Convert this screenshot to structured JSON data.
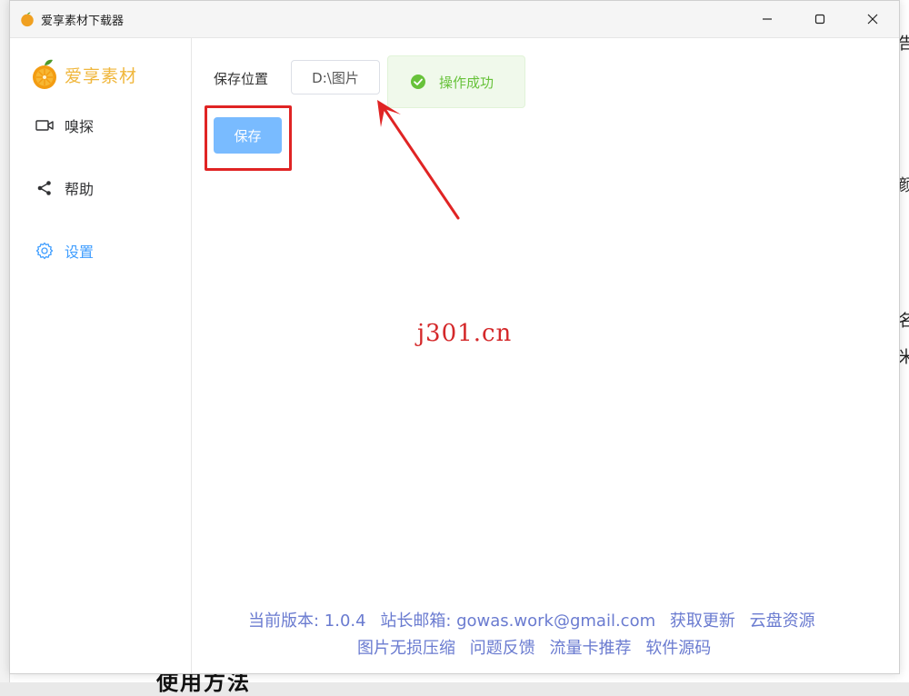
{
  "window": {
    "title": "爱享素材下载器"
  },
  "sidebar": {
    "brand": "爱享素材",
    "items": [
      {
        "label": "嗅探",
        "icon": "video-camera-icon"
      },
      {
        "label": "帮助",
        "icon": "share-icon"
      },
      {
        "label": "设置",
        "icon": "gear-icon"
      }
    ],
    "active_index": 2
  },
  "settings": {
    "save_location_label": "保存位置",
    "save_path_value": "D:\\图片",
    "save_button_label": "保存"
  },
  "toast": {
    "message": "操作成功",
    "icon": "success-check-icon"
  },
  "watermark": "j301.cn",
  "footer": {
    "version_label": "当前版本: 1.0.4",
    "email_label": "站长邮箱: gowas.work@gmail.com",
    "update_link": "获取更新",
    "cloud_link": "云盘资源",
    "compress_link": "图片无损压缩",
    "feedback_link": "问题反馈",
    "sim_link": "流量卡推荐",
    "source_link": "软件源码"
  },
  "colors": {
    "accent": "#409eff",
    "brand": "#f0b73d",
    "success": "#67c23a",
    "footer_link": "#6a7bd0",
    "highlight": "#e02424",
    "save_button": "#79bbff"
  }
}
